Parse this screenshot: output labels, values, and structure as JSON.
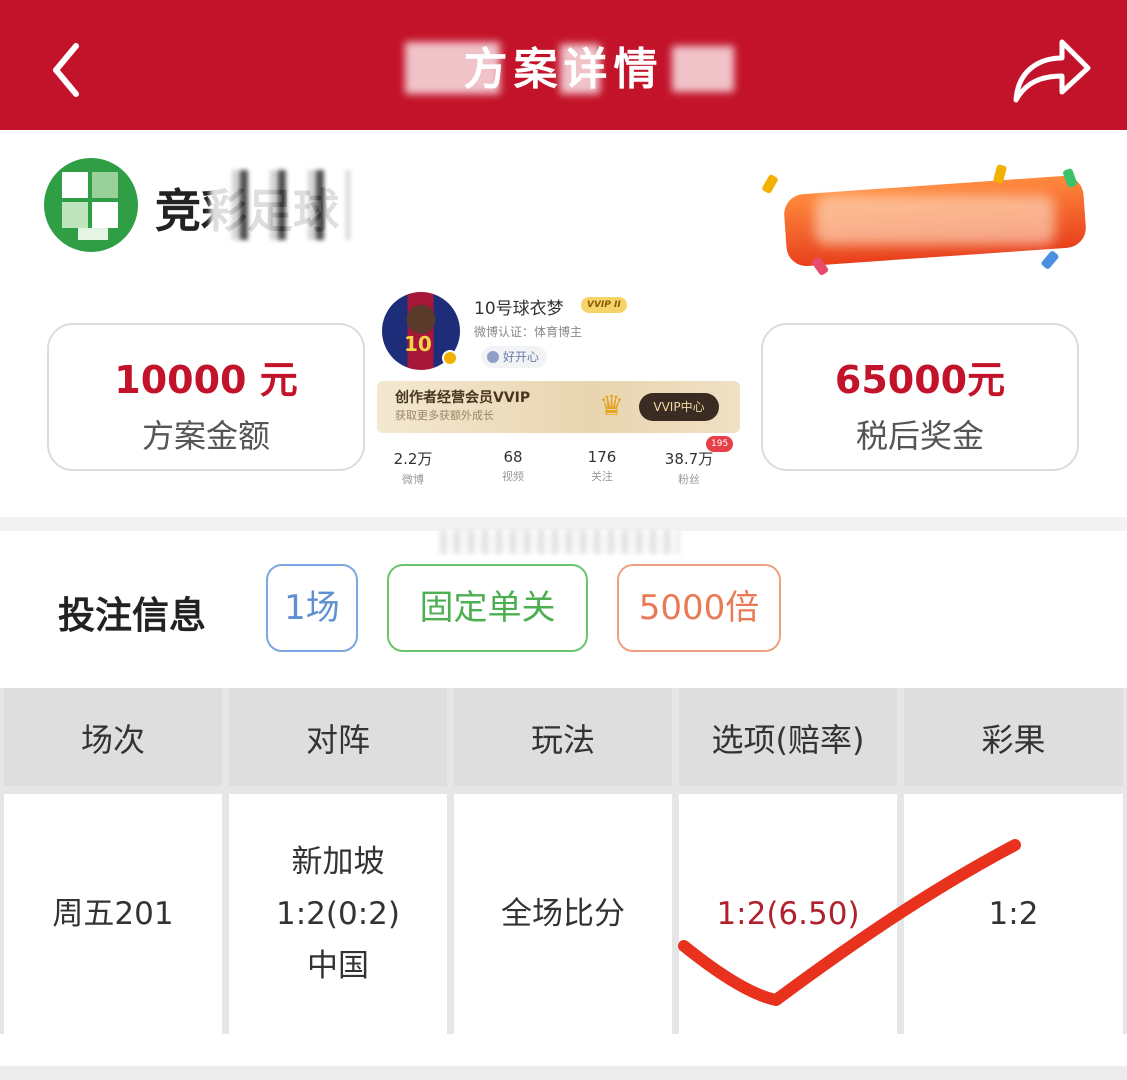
{
  "header": {
    "title": "方案详情",
    "bg_color": "#c3132a",
    "back_icon": "chevron-left-icon",
    "share_icon": "share-icon"
  },
  "brand": {
    "name": "竞彩足球",
    "logo_icon": "lottery-logo-icon"
  },
  "stats": {
    "amount_value": "10000 元",
    "amount_label": "方案金额",
    "prize_value": "65000元",
    "prize_label": "税后奖金"
  },
  "profile": {
    "name": "10号球衣梦",
    "vip_tag": "VVIP II",
    "cert": "微博认证：体育博主",
    "mood": "好开心",
    "vvip_title": "创作者经营会员VVIP",
    "vvip_sub": "获取更多获额外成长",
    "vvip_button": "VVIP中心",
    "badge": "195",
    "stats": [
      {
        "num": "2.2万",
        "label": "微博"
      },
      {
        "num": "68",
        "label": "视频"
      },
      {
        "num": "176",
        "label": "关注"
      },
      {
        "num": "38.7万",
        "label": "粉丝"
      }
    ]
  },
  "bet": {
    "title": "投注信息",
    "tags": [
      "1场",
      "固定单关",
      "5000倍"
    ]
  },
  "table": {
    "headers": [
      "场次",
      "对阵",
      "玩法",
      "选项(赔率)",
      "彩果"
    ],
    "row": {
      "match_no": "周五201",
      "home": "新加坡",
      "score": "1:2(0:2)",
      "away": "中国",
      "play": "全场比分",
      "option": "1:2(6.50)",
      "result": "1:2"
    }
  },
  "colors": {
    "accent_red": "#c3132a",
    "check_red": "#e8321e",
    "tag_blue": "#5e8fd0",
    "tag_green": "#4caf50",
    "tag_orange": "#e87a55"
  }
}
